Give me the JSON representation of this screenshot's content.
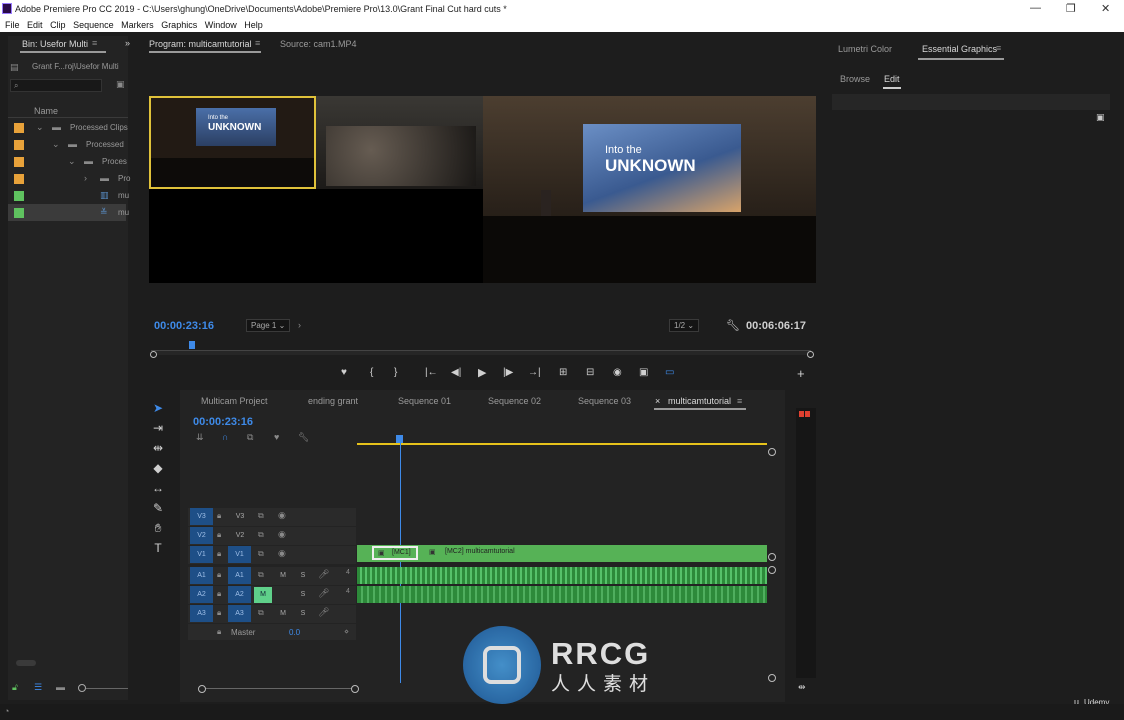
{
  "window": {
    "title": "Adobe Premiere Pro CC 2019 - C:\\Users\\ghung\\OneDrive\\Documents\\Adobe\\Premiere Pro\\13.0\\Grant Final Cut hard cuts *",
    "minimize": "—",
    "maximize": "❐",
    "close": "✕"
  },
  "menu": [
    "File",
    "Edit",
    "Clip",
    "Sequence",
    "Markers",
    "Graphics",
    "Window",
    "Help"
  ],
  "project": {
    "tab": "Bin: Usefor Multi",
    "path": "Grant F...roj\\Usefor Multi",
    "column_name": "Name",
    "rows": [
      {
        "label": "Processed Clips",
        "color": "#e8a23a"
      },
      {
        "label": "Processed",
        "color": "#e8a23a"
      },
      {
        "label": "Proces",
        "color": "#e8a23a"
      },
      {
        "label": "Pro",
        "color": "#e8a23a"
      },
      {
        "label": "mu",
        "color": "#5fc25f"
      },
      {
        "label": "mu",
        "color": "#5fc25f"
      }
    ]
  },
  "program": {
    "tab": "Program: multicamtutorial",
    "source_tab": "Source: cam1.MP4",
    "timecode": "00:00:23:16",
    "page_select": "Page 1",
    "zoom_select": "1/2",
    "duration": "00:06:06:17",
    "slide_line1": "Into the",
    "slide_line2": "UNKNOWN",
    "controls": [
      "♥",
      "{",
      "}",
      "|←",
      "◀|",
      "▶",
      "|▶",
      "→|",
      "⊞",
      "⊟",
      "◉",
      "▣",
      "▭"
    ],
    "add_btn": "+"
  },
  "timeline": {
    "tabs": [
      "Multicam Project",
      "ending grant",
      "Sequence 01",
      "Sequence 02",
      "Sequence 03",
      "multicamtutorial"
    ],
    "close_x": "×",
    "menu_icon": "≡",
    "timecode": "00:00:23:16",
    "video_tracks": [
      {
        "src": "V3",
        "tgt": "V3"
      },
      {
        "src": "V2",
        "tgt": "V2"
      },
      {
        "src": "V1",
        "tgt": "V1"
      }
    ],
    "audio_tracks": [
      {
        "src": "A1",
        "tgt": "A1"
      },
      {
        "src": "A2",
        "tgt": "A2"
      },
      {
        "src": "A3",
        "tgt": "A3"
      }
    ],
    "m_label": "M",
    "s_label": "S",
    "master_label": "Master",
    "master_value": "0.0",
    "clip1": "[MC1]",
    "clip2": "[MC2] multicamtutorial"
  },
  "right": {
    "tabs": [
      "Lumetri Color",
      "Essential Graphics"
    ],
    "subtabs": [
      "Browse",
      "Edit"
    ]
  },
  "watermark": {
    "brand": "RRCG",
    "sub": "人人素材",
    "udemy": "Udemy"
  },
  "colors": {
    "accent_blue": "#3e8ae8",
    "clip_green": "#56b256",
    "playhead": "#3e8ae8",
    "work_area": "#e6c21b"
  }
}
